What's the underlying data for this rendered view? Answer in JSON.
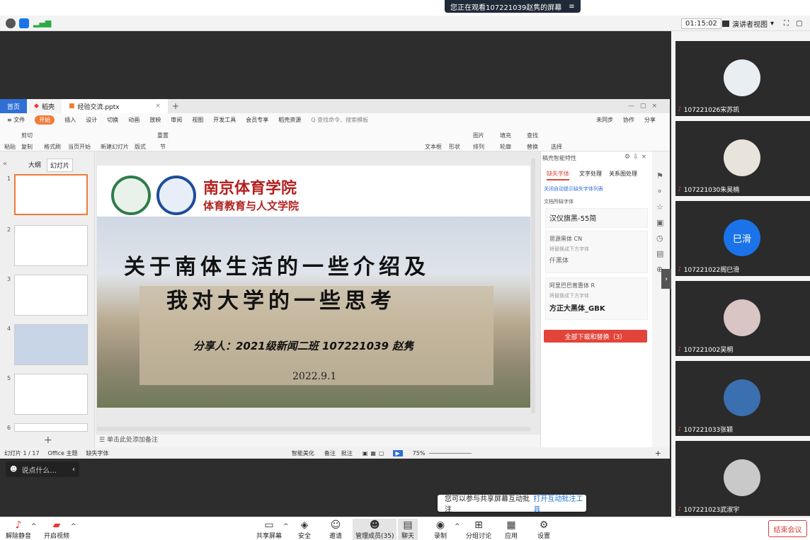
{
  "banner": {
    "viewing": "您正在观看107221039赵隽的屏幕",
    "menu_icon": "≡"
  },
  "timer": "01:15:02",
  "presenter_view": "演讲者视图",
  "ppt": {
    "tabs": [
      "首页",
      "稻壳",
      "经验交流.pptx"
    ],
    "menu": [
      "≡ 文件",
      "开始",
      "插入",
      "设计",
      "切换",
      "动画",
      "放映",
      "审阅",
      "视图",
      "开发工具",
      "会员专享",
      "稻壳资源",
      "Q 查找命令、搜索模板"
    ],
    "menu_right": [
      "未同步",
      "协作",
      "分享"
    ],
    "ribbon": [
      "粘贴",
      "剪切",
      "复制",
      "格式刷",
      "当页开始",
      "新建幻灯片",
      "版式",
      "节",
      "重置",
      "文本框",
      "形状",
      "排列",
      "轮廓",
      "图片",
      "填充",
      "查找",
      "替换",
      "选择"
    ],
    "panel_tabs": [
      "大纲",
      "幻灯片"
    ],
    "slide_nums": [
      "1",
      "2",
      "3",
      "4",
      "5",
      "6"
    ],
    "slide": {
      "school": "南京体育学院",
      "dept": "体育教育与人文学院",
      "title1": "关于南体生活的一些介绍及",
      "title2": "我对大学的一些思考",
      "sharer": "分享人：2021级新闻二班 107221039  赵隽",
      "date": "2022.9.1"
    },
    "note": "单击此处添加备注",
    "status_left": [
      "幻灯片 1 / 17",
      "Office 主题",
      "缺失字体"
    ],
    "status_right": [
      "智能美化",
      "备注",
      "批注",
      "75%"
    ],
    "right_panel": {
      "title": "稿壳智能特性",
      "tabs": [
        "缺失字体",
        "文字处理",
        "关系图处理"
      ],
      "link": "关闭自动提示缺失字体列表",
      "section": "文档所缺字体",
      "f1": "汉仪旗黑-55简",
      "f2": "思源黑体 CN",
      "f2hint": "将替换成下方字体",
      "f2rep": "仟黑体",
      "f3": "阿里巴巴普惠体 R",
      "f3hint": "将替换成下方字体",
      "f3rep": "方正大黑体_GBK",
      "button": "全部下载和替换（3）"
    }
  },
  "chat": "说点什么...",
  "tip": {
    "text": "您可以参与共享屏幕互动批注",
    "link": "打开互动批注工具"
  },
  "participants": [
    {
      "name": "107221026宋苏凯",
      "color": "#e9eef3"
    },
    {
      "name": "107221030朱昊楠",
      "color": "#e8e4dc"
    },
    {
      "name": "107221022阁巳滑",
      "initial": "巳滑",
      "color": "#1a73e8"
    },
    {
      "name": "107221002吴桐",
      "color": "#d9c6c4"
    },
    {
      "name": "107221033张颖",
      "color": "#3a6fb0"
    },
    {
      "name": "107221023武淑宇",
      "color": "#c9c9c9"
    }
  ],
  "toolbar": {
    "left": [
      "解除静音",
      "开启视频"
    ],
    "center": [
      "共享屏幕",
      "安全",
      "邀请",
      "管理成员(35)",
      "聊天",
      "录制",
      "分组讨论",
      "应用",
      "设置"
    ],
    "end": "结束会议"
  }
}
